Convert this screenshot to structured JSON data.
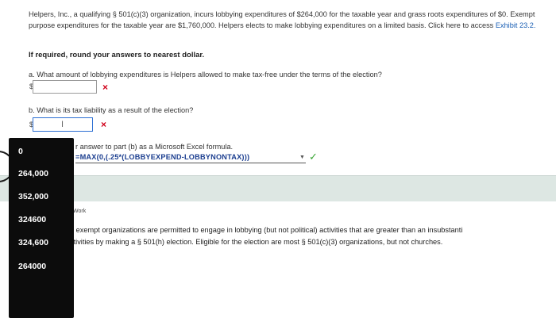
{
  "intro": {
    "text": "Helpers, Inc., a qualifying § 501(c)(3) organization, incurs lobbying expenditures of $264,000 for the taxable year and grass roots expenditures of $0. Exempt purpose expenditures for the taxable year are $1,760,000. Helpers elects to make lobbying expenditures on a limited basis. Click here to access",
    "link": "Exhibit 23.2."
  },
  "round_note": "If required, round your answers to nearest dollar.",
  "question_a": {
    "label": "a. What amount of lobbying expenditures is Helpers allowed to make tax-free under the terms of the election?",
    "currency": "$",
    "value": "",
    "mark": "×"
  },
  "question_b": {
    "label": "b. What is its tax liability as a result of the election?",
    "currency": "$",
    "value": "",
    "mark": "×"
  },
  "excel": {
    "note": "r answer to part (b) as a Microsoft Excel formula.",
    "formula": "=MAX(0,(.25*(LOBBYEXPEND-LOBBYNONTAX)))",
    "check": "✓"
  },
  "work_label": "Work",
  "explanation": {
    "line1": "h exempt organizations are permitted to engage in lobbying (but not political) activities that are greater than an insubstanti",
    "line2": "ctivities by making a § 501(h) election. Eligible for the election are most § 501(c)(3) organizations, but not churches."
  },
  "autocomplete": {
    "items": [
      "0",
      "264,000",
      "352,000",
      "324600",
      "324,600",
      "264000"
    ]
  },
  "colors": {
    "link": "#1a5fb4",
    "error": "#d0021b",
    "success": "#3aa635",
    "band": "#dde7e3",
    "dropdown_bg": "#0c0c0c"
  }
}
